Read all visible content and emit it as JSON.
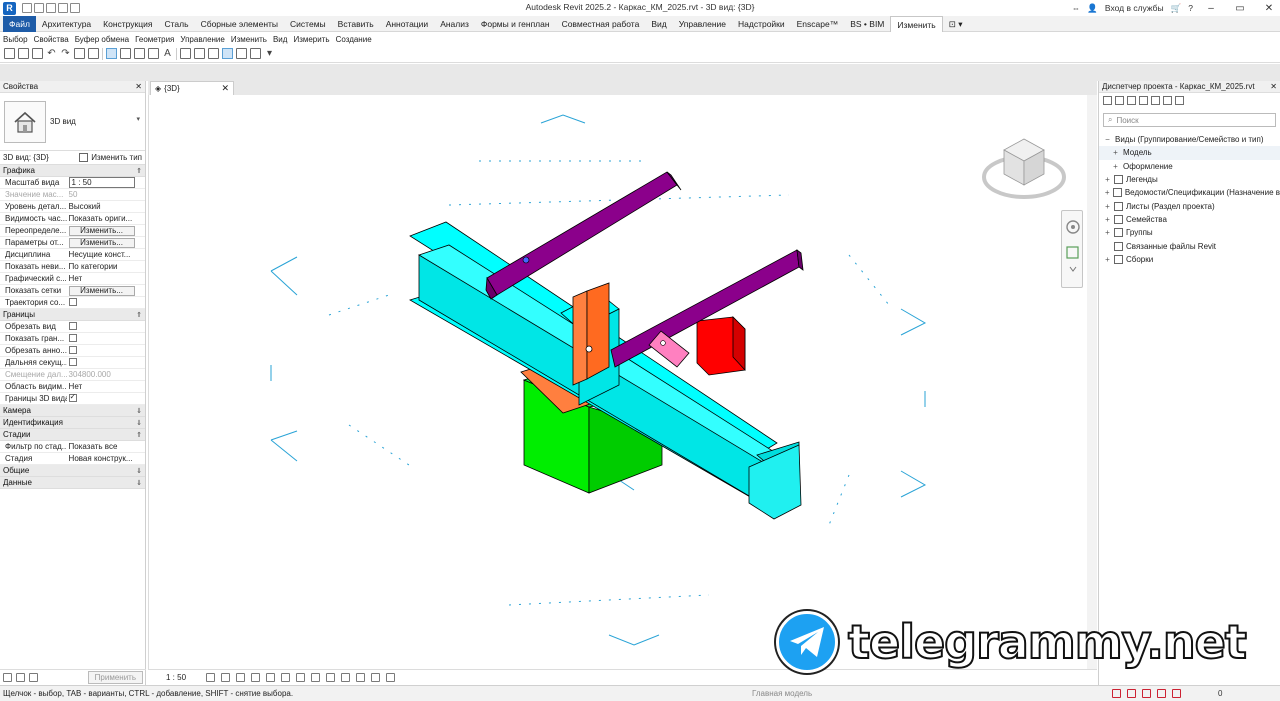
{
  "window": {
    "title": "Autodesk Revit 2025.2 - Каркас_КМ_2025.rvt - 3D вид: {3D}",
    "login": "Вход в службы",
    "app_logo": "R"
  },
  "ribbon": {
    "tabs": [
      "Файл",
      "Архитектура",
      "Конструкция",
      "Сталь",
      "Сборные элементы",
      "Системы",
      "Вставить",
      "Аннотации",
      "Анализ",
      "Формы и генплан",
      "Совместная работа",
      "Вид",
      "Управление",
      "Надстройки",
      "Enscape™",
      "BS • BIM",
      "Изменить"
    ],
    "active_tab": "Изменить",
    "panels": [
      "Выбор",
      "Свойства",
      "Буфер обмена",
      "Геометрия",
      "Управление",
      "Изменить",
      "Вид",
      "Измерить",
      "Создание"
    ]
  },
  "properties": {
    "header": "Свойства",
    "type_name": "3D вид",
    "view_selector": "3D вид: {3D}",
    "edit_type": "Изменить тип",
    "groups": [
      {
        "name": "Графика",
        "toggle": "⇑",
        "rows": [
          {
            "name": "Масштаб вида",
            "value": "1 : 50",
            "kind": "input"
          },
          {
            "name": "Значение мас...",
            "value": "50",
            "kind": "disabled"
          },
          {
            "name": "Уровень детал...",
            "value": "Высокий",
            "kind": "text"
          },
          {
            "name": "Видимость час...",
            "value": "Показать ориги...",
            "kind": "text"
          },
          {
            "name": "Переопределе...",
            "value": "Изменить...",
            "kind": "button"
          },
          {
            "name": "Параметры от...",
            "value": "Изменить...",
            "kind": "button"
          },
          {
            "name": "Дисциплина",
            "value": "Несущие конст...",
            "kind": "text"
          },
          {
            "name": "Показать неви...",
            "value": "По категории",
            "kind": "text"
          },
          {
            "name": "Графический с...",
            "value": "Нет",
            "kind": "text"
          },
          {
            "name": "Показать сетки",
            "value": "Изменить...",
            "kind": "button"
          },
          {
            "name": "Траектория со...",
            "value": "",
            "kind": "checkbox"
          }
        ]
      },
      {
        "name": "Границы",
        "toggle": "⇑",
        "rows": [
          {
            "name": "Обрезать вид",
            "value": "",
            "kind": "checkbox"
          },
          {
            "name": "Показать гран...",
            "value": "",
            "kind": "checkbox"
          },
          {
            "name": "Обрезать анно...",
            "value": "",
            "kind": "checkbox"
          },
          {
            "name": "Дальняя секущ...",
            "value": "",
            "kind": "checkbox"
          },
          {
            "name": "Смещение дал...",
            "value": "304800.000",
            "kind": "disabled"
          },
          {
            "name": "Область видим...",
            "value": "Нет",
            "kind": "text"
          },
          {
            "name": "Границы 3D вида",
            "value": "",
            "kind": "checkbox-on"
          }
        ]
      },
      {
        "name": "Камера",
        "toggle": "⇓",
        "rows": []
      },
      {
        "name": "Идентификация",
        "toggle": "⇓",
        "rows": []
      },
      {
        "name": "Стадии",
        "toggle": "⇑",
        "rows": [
          {
            "name": "Фильтр по стад...",
            "value": "Показать все",
            "kind": "text"
          },
          {
            "name": "Стадия",
            "value": "Новая конструк...",
            "kind": "text"
          }
        ]
      },
      {
        "name": "Общие",
        "toggle": "⇓",
        "rows": []
      },
      {
        "name": "Данные",
        "toggle": "⇓",
        "rows": []
      }
    ],
    "apply": "Применить"
  },
  "view": {
    "tab_label": "{3D}",
    "scale": "1 : 50",
    "colors": {
      "beam": "#00ffff",
      "angle": "#800080",
      "plate": "#ff8040",
      "column": "#00ff00",
      "block": "#ff0000",
      "clip": "#ff80c0",
      "grid": "#29a3d6"
    }
  },
  "browser": {
    "header": "Диспетчер проекта - Каркас_КМ_2025.rvt",
    "search_placeholder": "Поиск",
    "items": [
      {
        "label": "Виды (Группирование/Семейство и тип)",
        "exp": "−",
        "indent": 0,
        "selected": false,
        "icon": false
      },
      {
        "label": "Модель",
        "exp": "+",
        "indent": 1,
        "selected": true,
        "icon": false
      },
      {
        "label": "Оформление",
        "exp": "+",
        "indent": 1,
        "selected": false,
        "icon": false
      },
      {
        "label": "Легенды",
        "exp": "+",
        "indent": 0,
        "selected": false,
        "icon": true
      },
      {
        "label": "Ведомости/Спецификации (Назначение в",
        "exp": "+",
        "indent": 0,
        "selected": false,
        "icon": true
      },
      {
        "label": "Листы (Раздел проекта)",
        "exp": "+",
        "indent": 0,
        "selected": false,
        "icon": true
      },
      {
        "label": "Семейства",
        "exp": "+",
        "indent": 0,
        "selected": false,
        "icon": true
      },
      {
        "label": "Группы",
        "exp": "+",
        "indent": 0,
        "selected": false,
        "icon": true
      },
      {
        "label": "Связанные файлы Revit",
        "exp": "",
        "indent": 0,
        "selected": false,
        "icon": true
      },
      {
        "label": "Сборки",
        "exp": "+",
        "indent": 0,
        "selected": false,
        "icon": true
      }
    ]
  },
  "status": {
    "hint": "Щелчок - выбор, TAB - варианты, CTRL - добавление, SHIFT - снятие выбора.",
    "worksets": "0",
    "model": "Главная модель",
    "filter": "0"
  },
  "watermark": {
    "text": "telegrammy.net"
  }
}
